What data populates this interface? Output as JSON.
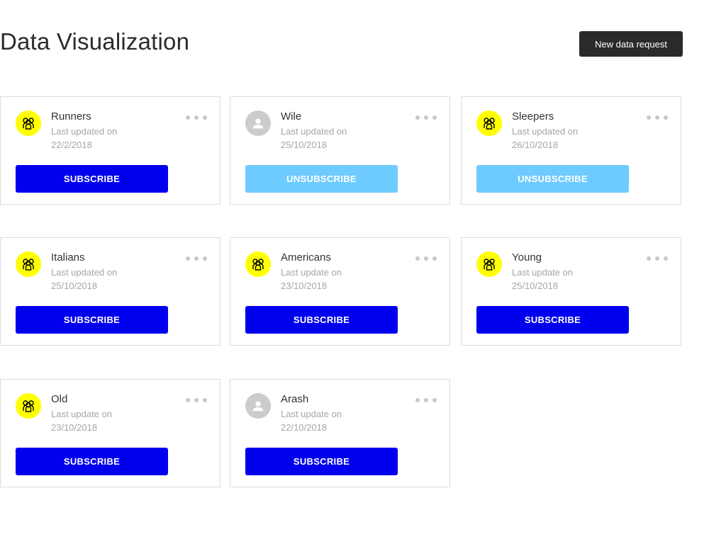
{
  "header": {
    "title": "Data Visualization",
    "new_request_label": "New data request"
  },
  "colors": {
    "subscribe": "#0000ee",
    "unsubscribe": "#6ecbff",
    "group_avatar": "#ffff00",
    "person_avatar": "#cccccc",
    "header_button": "#2a2a2a"
  },
  "cards": [
    {
      "name": "Runners",
      "meta_label": "Last updated on",
      "date": "22/2/2018",
      "avatar": "group-icon",
      "action_label": "SUBSCRIBE",
      "action_state": "subscribe"
    },
    {
      "name": "Wile",
      "meta_label": "Last updated on",
      "date": "25/10/2018",
      "avatar": "person-icon",
      "action_label": "UNSUBSCRIBE",
      "action_state": "unsubscribe"
    },
    {
      "name": "Sleepers",
      "meta_label": "Last updated on",
      "date": "26/10/2018",
      "avatar": "group-icon",
      "action_label": "UNSUBSCRIBE",
      "action_state": "unsubscribe"
    },
    {
      "name": "Italians",
      "meta_label": "Last updated on",
      "date": "25/10/2018",
      "avatar": "group-icon",
      "action_label": "SUBSCRIBE",
      "action_state": "subscribe"
    },
    {
      "name": "Americans",
      "meta_label": "Last update on",
      "date": "23/10/2018",
      "avatar": "group-icon",
      "action_label": "SUBSCRIBE",
      "action_state": "subscribe"
    },
    {
      "name": "Young",
      "meta_label": "Last update on",
      "date": "25/10/2018",
      "avatar": "group-icon",
      "action_label": "SUBSCRIBE",
      "action_state": "subscribe"
    },
    {
      "name": "Old",
      "meta_label": "Last update on",
      "date": "23/10/2018",
      "avatar": "group-icon",
      "action_label": "SUBSCRIBE",
      "action_state": "subscribe"
    },
    {
      "name": "Arash",
      "meta_label": "Last update on",
      "date": "22/10/2018",
      "avatar": "person-icon",
      "action_label": "SUBSCRIBE",
      "action_state": "subscribe"
    }
  ]
}
